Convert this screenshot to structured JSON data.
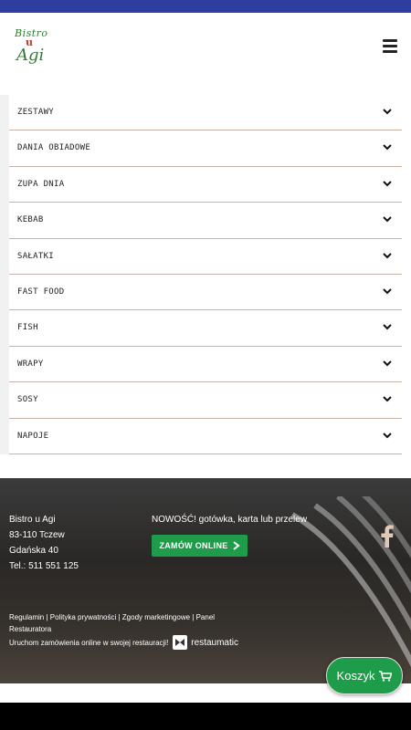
{
  "logo": {
    "line1": "Bistro",
    "line2": "u",
    "line3": "Agi"
  },
  "menu": {
    "items": [
      {
        "label": "ZESTAWY"
      },
      {
        "label": "DANIA OBIADOWE"
      },
      {
        "label": "ZUPA DNIA"
      },
      {
        "label": "KEBAB"
      },
      {
        "label": "SAŁATKI"
      },
      {
        "label": "FAST FOOD"
      },
      {
        "label": "FISH"
      },
      {
        "label": "WRAPY"
      },
      {
        "label": "SOSY"
      },
      {
        "label": "NAPOJE"
      }
    ]
  },
  "footer": {
    "name": "Bistro u Agi",
    "city": "83-110 Tczew",
    "street": "Gdańska 40",
    "tel": "Tel.: 511 551 125",
    "news": "NOWOŚĆ! gotówka, karta lub przelew",
    "order_label": "ZAMÓW ONLINE",
    "links": {
      "regulamin": "Regulamin",
      "polityka": "Polityka prywatności",
      "zgody": "Zgody marketingowe",
      "panel": "Panel Restauratora"
    },
    "powered_text": "Uruchom zamówienia online w swojej restauracji!",
    "powered_brand": "restaumatic"
  },
  "cart": {
    "label": "Koszyk"
  },
  "colors": {
    "statusbar": "#2f3e9e",
    "green": "#1e9c4a",
    "divider": "#c9b6a8"
  }
}
